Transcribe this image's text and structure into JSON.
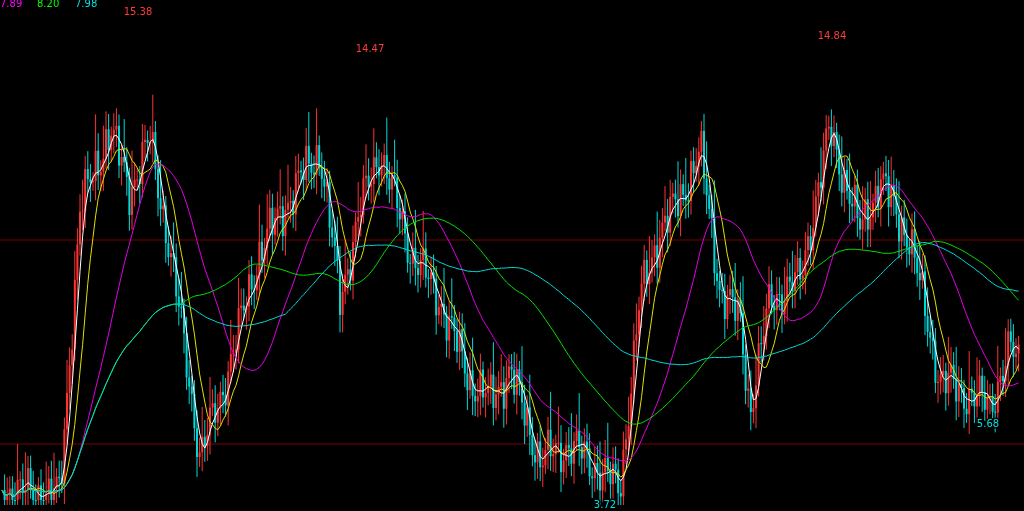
{
  "indicator_values": [
    {
      "text": "7.89",
      "color": "#ff00ff"
    },
    {
      "text": "8.20",
      "color": "#00ff00"
    },
    {
      "text": "7.98",
      "color": "#00e0e0"
    }
  ],
  "price_marks": [
    {
      "text": "15.38",
      "color": "#ff3b3b"
    },
    {
      "text": "14.47",
      "color": "#ff3b3b"
    },
    {
      "text": "14.84",
      "color": "#ff3b3b"
    },
    {
      "text": "3.72",
      "color": "#00e0e0"
    },
    {
      "text": "5.68",
      "color": "#00e0e0"
    }
  ]
}
